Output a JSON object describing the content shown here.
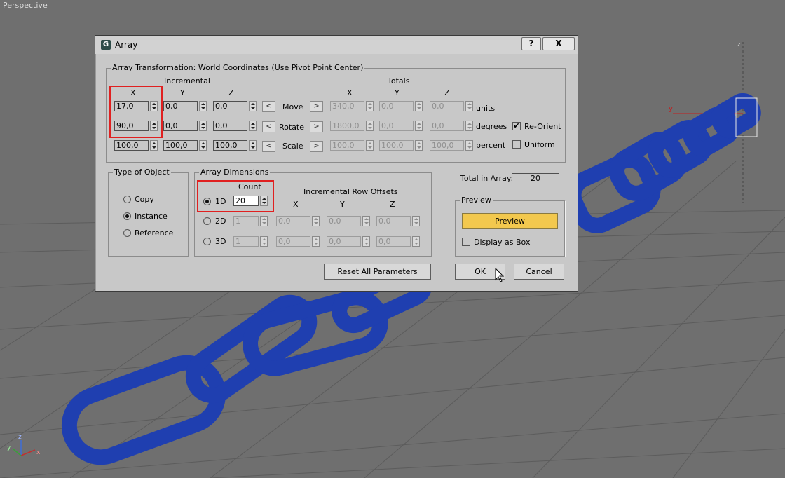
{
  "viewport": {
    "label": "Perspective",
    "axis_x": "x",
    "axis_y": "y",
    "axis_z": "z",
    "axis_small_y": "y"
  },
  "dialog": {
    "title": "Array",
    "help_button": "?",
    "close_button": "X",
    "transform_group": "Array Transformation: World Coordinates (Use Pivot Point Center)",
    "incremental_label": "Incremental",
    "totals_label": "Totals",
    "axis_x": "X",
    "axis_y": "Y",
    "axis_z": "Z",
    "rows": {
      "move": {
        "label": "Move",
        "inc": [
          "17,0",
          "0,0",
          "0,0"
        ],
        "tot": [
          "340,0",
          "0,0",
          "0,0"
        ],
        "unit": "units"
      },
      "rotate": {
        "label": "Rotate",
        "inc": [
          "90,0",
          "0,0",
          "0,0"
        ],
        "tot": [
          "1800,0",
          "0,0",
          "0,0"
        ],
        "unit": "degrees"
      },
      "scale": {
        "label": "Scale",
        "inc": [
          "100,0",
          "100,0",
          "100,0"
        ],
        "tot": [
          "100,0",
          "100,0",
          "100,0"
        ],
        "unit": "percent"
      }
    },
    "arrow_left": "<",
    "arrow_right": ">",
    "re_orient": "Re-Orient",
    "uniform": "Uniform",
    "type_group": "Type of Object",
    "type_copy": "Copy",
    "type_instance": "Instance",
    "type_reference": "Reference",
    "dims_group": "Array Dimensions",
    "count_label": "Count",
    "row_offsets_label": "Incremental Row Offsets",
    "dim_1d": "1D",
    "dim_2d": "2D",
    "dim_3d": "3D",
    "count_1d": "20",
    "count_2d": "1",
    "count_3d": "1",
    "offset_2d": [
      "0,0",
      "0,0",
      "0,0"
    ],
    "offset_3d": [
      "0,0",
      "0,0",
      "0,0"
    ],
    "total_label": "Total in Array:",
    "total_value": "20",
    "preview_group": "Preview",
    "preview_button": "Preview",
    "display_box": "Display as Box",
    "reset_button": "Reset All Parameters",
    "ok_button": "OK",
    "cancel_button": "Cancel",
    "checkmark": "✔"
  },
  "colors": {
    "chain": "#2244b8",
    "highlight": "#e02020",
    "preview": "#f2c84e"
  }
}
